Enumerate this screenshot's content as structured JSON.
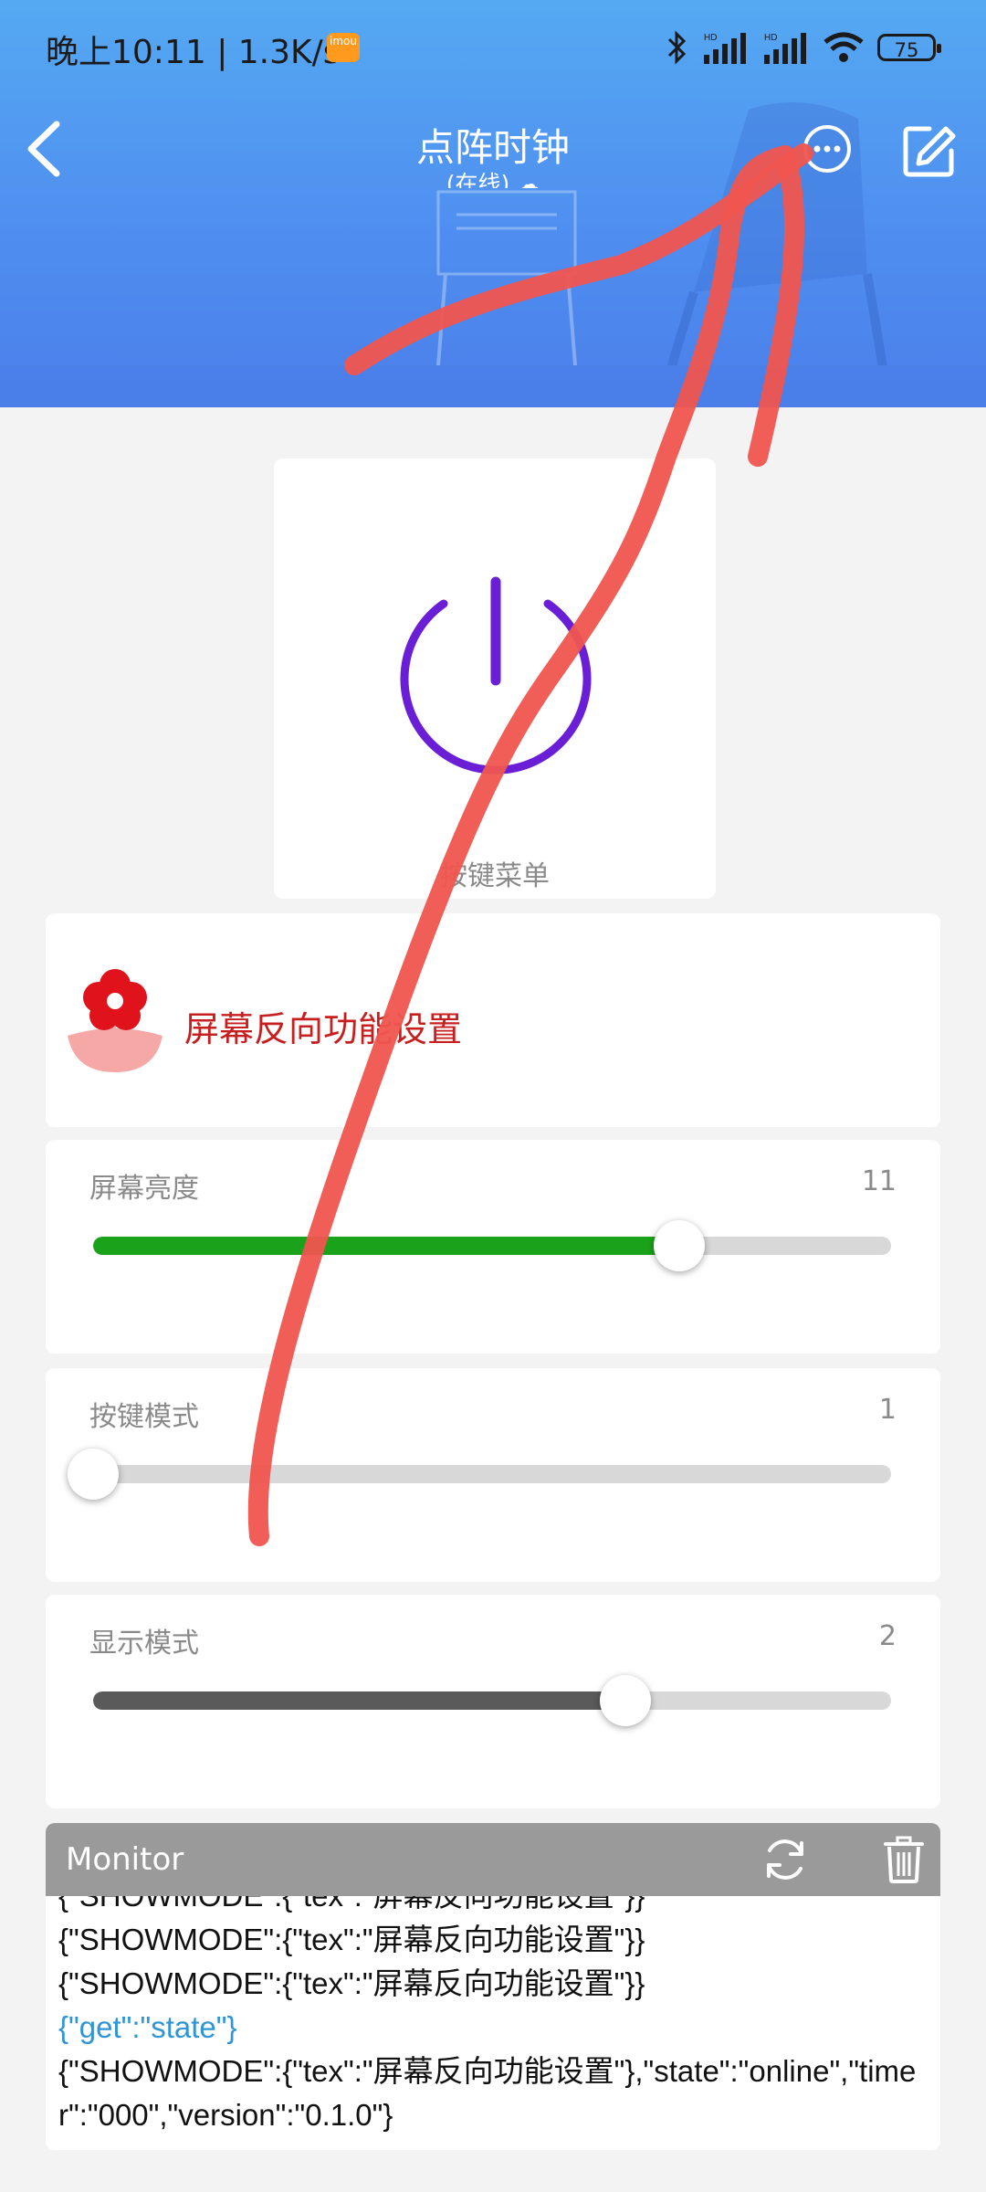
{
  "status_bar": {
    "time": "晚上10:11 | 1.3K/s",
    "app_badge": "imou",
    "battery": "75"
  },
  "header": {
    "title": "点阵时钟",
    "subtitle": "(在线)",
    "back_icon": "chevron-left-icon",
    "more_icon": "more-dots-icon",
    "edit_icon": "edit-icon"
  },
  "power": {
    "label": "按键菜单",
    "color": "#6a1fd6"
  },
  "reverse": {
    "label": "屏幕反向功能设置",
    "icon": "flower-icon",
    "color": "#c71f1f"
  },
  "sliders": [
    {
      "label": "屏幕亮度",
      "value": "11",
      "fraction": 0.735,
      "fill_color": "#1aa31a"
    },
    {
      "label": "按键模式",
      "value": "1",
      "fraction": 0.0,
      "fill_color": "#d8d8d8"
    },
    {
      "label": "显示模式",
      "value": "2",
      "fraction": 0.667,
      "fill_color": "#5a5a5a"
    }
  ],
  "monitor": {
    "title": "Monitor",
    "refresh_icon": "refresh-icon",
    "trash_icon": "trash-icon",
    "lines": [
      {
        "text": "{\"SHOWMODE\":{\"tex\":\"屏幕反向功能设置\"}}",
        "sent": false
      },
      {
        "text": "{\"SHOWMODE\":{\"tex\":\"屏幕反向功能设置\"}}",
        "sent": false
      },
      {
        "text": "{\"SHOWMODE\":{\"tex\":\"屏幕反向功能设置\"}}",
        "sent": false
      },
      {
        "text": "{\"get\":\"state\"}",
        "sent": true
      },
      {
        "text": "{\"SHOWMODE\":{\"tex\":\"屏幕反向功能设置\"},\"state\":\"online\",\"timer\":\"000\",\"version\":\"0.1.0\"}",
        "sent": false
      }
    ]
  },
  "colors": {
    "header_top": "#55a9f2",
    "header_bottom": "#4b7fea",
    "annotation_stroke": "#f0554f",
    "page_bg": "#f3f3f3"
  }
}
